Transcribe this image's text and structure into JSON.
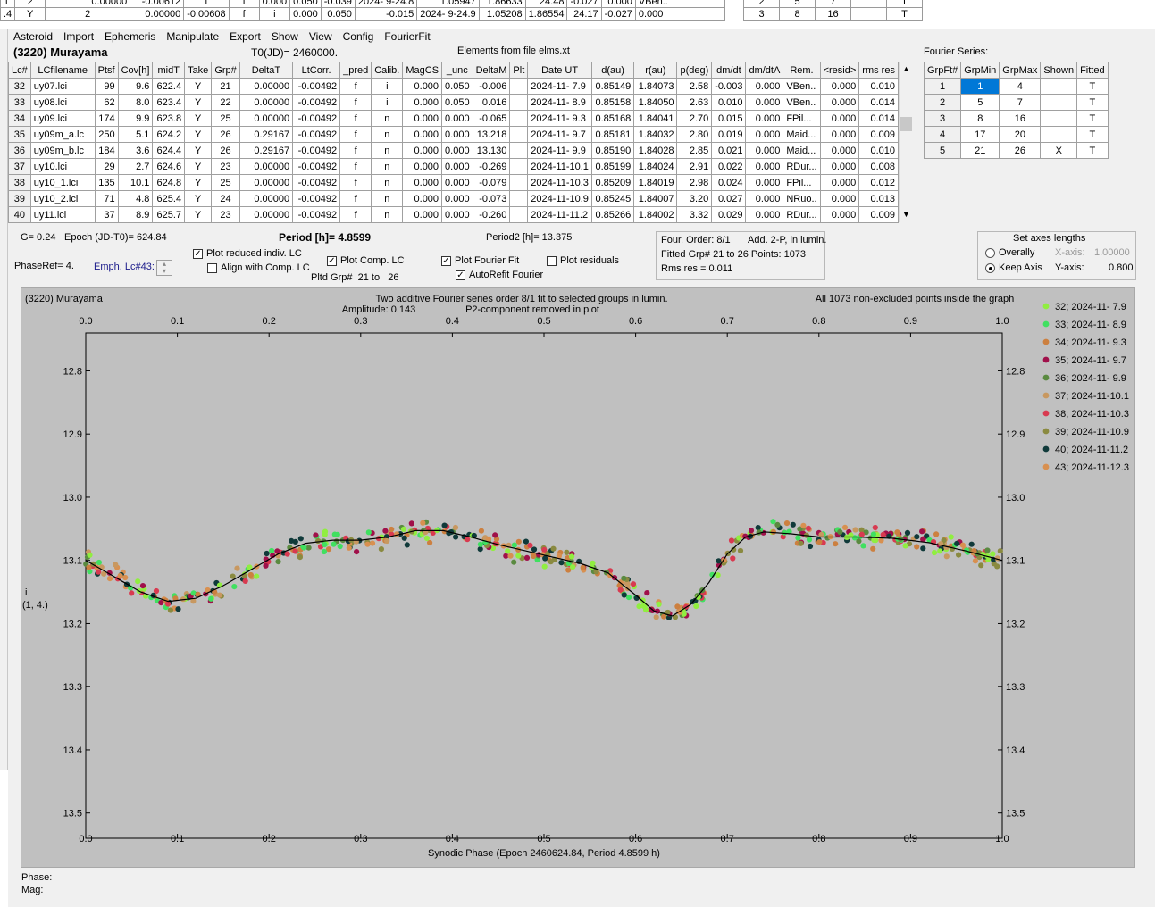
{
  "bg_grid": {
    "rows": [
      [
        "1",
        "2",
        "0.00000",
        "-0.00612",
        "f",
        "i",
        "0.000",
        "0.050",
        "-0.039",
        "2024- 9-24.8",
        "1.05947",
        "1.86633",
        "24.48",
        "-0.027",
        "0.000",
        "VBen.."
      ],
      [
        ".4",
        "Y",
        "2",
        "0.00000",
        "-0.00608",
        "f",
        "i",
        "0.000",
        "0.050",
        "-0.015",
        "2024- 9-24.9",
        "1.05208",
        "1.86554",
        "24.17",
        "-0.027",
        "0.000",
        "VBen.."
      ]
    ],
    "right_rows": [
      [
        "2",
        "5",
        "7",
        "",
        "T"
      ],
      [
        "3",
        "8",
        "16",
        "",
        "T"
      ]
    ]
  },
  "menu": [
    "Asteroid",
    "Import",
    "Ephemeris",
    "Manipulate",
    "Export",
    "Show",
    "View",
    "Config",
    "FourierFit"
  ],
  "header": {
    "asteroid_name": "(3220) Murayama",
    "t0": "T0(JD)= 2460000.",
    "elements_file": "Elements from file elms.xt",
    "fourier_series_label": "Fourier Series:"
  },
  "lc_table": {
    "columns": [
      "Lc#",
      "LCfilename",
      "Ptsf",
      "Cov[h]",
      "midT",
      "Take",
      "Grp#",
      "DeltaT",
      "LtCorr.",
      "_pred",
      "Calib.",
      "MagCS",
      "_unc",
      "DeltaM",
      "Plt",
      "Date UT",
      "d(au)",
      "r(au)",
      "p(deg)",
      "dm/dt",
      "dm/dtA",
      "Rem.",
      "<resid>",
      "rms res"
    ],
    "rows": [
      [
        "32",
        "uy07.lci",
        "99",
        "9.6",
        "622.4",
        "Y",
        "21",
        "0.00000",
        "-0.00492",
        "f",
        "i",
        "0.000",
        "0.050",
        "-0.006",
        "",
        "2024-11- 7.9",
        "0.85149",
        "1.84073",
        "2.58",
        "-0.003",
        "0.000",
        "VBen..",
        "0.000",
        "0.010"
      ],
      [
        "33",
        "uy08.lci",
        "62",
        "8.0",
        "623.4",
        "Y",
        "22",
        "0.00000",
        "-0.00492",
        "f",
        "i",
        "0.000",
        "0.050",
        "0.016",
        "",
        "2024-11- 8.9",
        "0.85158",
        "1.84050",
        "2.63",
        "0.010",
        "0.000",
        "VBen..",
        "0.000",
        "0.014"
      ],
      [
        "34",
        "uy09.lci",
        "174",
        "9.9",
        "623.8",
        "Y",
        "25",
        "0.00000",
        "-0.00492",
        "f",
        "n",
        "0.000",
        "0.000",
        "-0.065",
        "",
        "2024-11- 9.3",
        "0.85168",
        "1.84041",
        "2.70",
        "0.015",
        "0.000",
        "FPil...",
        "0.000",
        "0.014"
      ],
      [
        "35",
        "uy09m_a.lc",
        "250",
        "5.1",
        "624.2",
        "Y",
        "26",
        "0.29167",
        "-0.00492",
        "f",
        "n",
        "0.000",
        "0.000",
        "13.218",
        "",
        "2024-11- 9.7",
        "0.85181",
        "1.84032",
        "2.80",
        "0.019",
        "0.000",
        "Maid...",
        "0.000",
        "0.009"
      ],
      [
        "36",
        "uy09m_b.lc",
        "184",
        "3.6",
        "624.4",
        "Y",
        "26",
        "0.29167",
        "-0.00492",
        "f",
        "n",
        "0.000",
        "0.000",
        "13.130",
        "",
        "2024-11- 9.9",
        "0.85190",
        "1.84028",
        "2.85",
        "0.021",
        "0.000",
        "Maid...",
        "0.000",
        "0.010"
      ],
      [
        "37",
        "uy10.lci",
        "29",
        "2.7",
        "624.6",
        "Y",
        "23",
        "0.00000",
        "-0.00492",
        "f",
        "n",
        "0.000",
        "0.000",
        "-0.269",
        "",
        "2024-11-10.1",
        "0.85199",
        "1.84024",
        "2.91",
        "0.022",
        "0.000",
        "RDur...",
        "0.000",
        "0.008"
      ],
      [
        "38",
        "uy10_1.lci",
        "135",
        "10.1",
        "624.8",
        "Y",
        "25",
        "0.00000",
        "-0.00492",
        "f",
        "n",
        "0.000",
        "0.000",
        "-0.079",
        "",
        "2024-11-10.3",
        "0.85209",
        "1.84019",
        "2.98",
        "0.024",
        "0.000",
        "FPil...",
        "0.000",
        "0.012"
      ],
      [
        "39",
        "uy10_2.lci",
        "71",
        "4.8",
        "625.4",
        "Y",
        "24",
        "0.00000",
        "-0.00492",
        "f",
        "n",
        "0.000",
        "0.000",
        "-0.073",
        "",
        "2024-11-10.9",
        "0.85245",
        "1.84007",
        "3.20",
        "0.027",
        "0.000",
        "NRuo..",
        "0.000",
        "0.013"
      ],
      [
        "40",
        "uy11.lci",
        "37",
        "8.9",
        "625.7",
        "Y",
        "23",
        "0.00000",
        "-0.00492",
        "f",
        "n",
        "0.000",
        "0.000",
        "-0.260",
        "",
        "2024-11-11.2",
        "0.85266",
        "1.84002",
        "3.32",
        "0.029",
        "0.000",
        "RDur...",
        "0.000",
        "0.009"
      ]
    ]
  },
  "fourier_table": {
    "columns": [
      "GrpFt#",
      "GrpMin",
      "GrpMax",
      "Shown",
      "Fitted"
    ],
    "rows": [
      [
        "1",
        "1",
        "4",
        "",
        "T"
      ],
      [
        "2",
        "5",
        "7",
        "",
        "T"
      ],
      [
        "3",
        "8",
        "16",
        "",
        "T"
      ],
      [
        "4",
        "17",
        "20",
        "",
        "T"
      ],
      [
        "5",
        "21",
        "26",
        "X",
        "T"
      ]
    ]
  },
  "info": {
    "g": "G= 0.24",
    "epoch": "Epoch (JD-T0)= 624.84",
    "period": "Period [h]= 4.8599",
    "period2": "Period2 [h]= 13.375",
    "phaseref": "PhaseRef= 4.",
    "emph": "Emph. Lc#43:",
    "plot_reduced": "Plot reduced indiv. LC",
    "align_comp": "Align with Comp. LC",
    "plot_comp": "Plot Comp. LC",
    "pltd_grp": "Pltd Grp#",
    "grp_from": "21",
    "grp_to_label": "to",
    "grp_to": "26",
    "plot_fourier": "Plot Fourier Fit",
    "autorefit": "AutoRefit Fourier",
    "plot_residuals": "Plot residuals",
    "four_order": "Four. Order:  8/1",
    "add_2p": "Add. 2-P,  in lumin.",
    "fitted_grp": "Fitted Grp# 21 to 26 Points: 1073",
    "rms": "Rms res      = 0.011"
  },
  "axes_box": {
    "title": "Set axes lengths",
    "overally": "Overally",
    "keep_axis": "Keep Axis",
    "x_label": "X-axis:",
    "x_value": "1.00000",
    "y_label": "Y-axis:",
    "y_value": "0.800"
  },
  "chart_data": {
    "type": "scatter",
    "top_left": "(3220) Murayama",
    "subtitle1": "Two additive Fourier series order 8/1 fit to selected groups in lumin.",
    "subtitle2": "Amplitude: 0.143",
    "subtitle3": "P2-component removed in plot",
    "top_right": "All 1073 non-excluded points inside the graph",
    "xlabel": "Synodic Phase (Epoch 2460624.84, Period 4.8599 h)",
    "ylabel_line1": "i",
    "ylabel_line2": "(1, 4.)",
    "xlim": [
      0.0,
      1.0
    ],
    "ylim": [
      12.74,
      13.54
    ],
    "y_inverted": true,
    "x_ticks": [
      "0.0",
      "0.1",
      "0.2",
      "0.3",
      "0.4",
      "0.5",
      "0.6",
      "0.7",
      "0.8",
      "0.9",
      "1.0"
    ],
    "y_ticks": [
      "12.8",
      "12.9",
      "13.0",
      "13.1",
      "13.2",
      "13.3",
      "13.4",
      "13.5"
    ],
    "fit_curve": [
      [
        0.0,
        13.1
      ],
      [
        0.03,
        13.125
      ],
      [
        0.06,
        13.15
      ],
      [
        0.09,
        13.165
      ],
      [
        0.12,
        13.16
      ],
      [
        0.15,
        13.14
      ],
      [
        0.18,
        13.115
      ],
      [
        0.21,
        13.09
      ],
      [
        0.24,
        13.073
      ],
      [
        0.27,
        13.068
      ],
      [
        0.3,
        13.068
      ],
      [
        0.33,
        13.063
      ],
      [
        0.36,
        13.053
      ],
      [
        0.39,
        13.053
      ],
      [
        0.42,
        13.063
      ],
      [
        0.45,
        13.075
      ],
      [
        0.48,
        13.085
      ],
      [
        0.51,
        13.095
      ],
      [
        0.54,
        13.105
      ],
      [
        0.57,
        13.12
      ],
      [
        0.6,
        13.155
      ],
      [
        0.62,
        13.18
      ],
      [
        0.64,
        13.188
      ],
      [
        0.66,
        13.17
      ],
      [
        0.68,
        13.135
      ],
      [
        0.7,
        13.09
      ],
      [
        0.72,
        13.063
      ],
      [
        0.74,
        13.055
      ],
      [
        0.77,
        13.058
      ],
      [
        0.8,
        13.063
      ],
      [
        0.84,
        13.063
      ],
      [
        0.88,
        13.065
      ],
      [
        0.92,
        13.072
      ],
      [
        0.96,
        13.085
      ],
      [
        1.0,
        13.1
      ]
    ],
    "series": [
      {
        "name": "32; 2024-11- 7.9",
        "color": "#90ee40"
      },
      {
        "name": "33; 2024-11- 8.9",
        "color": "#40e060"
      },
      {
        "name": "34; 2024-11- 9.3",
        "color": "#cc8040"
      },
      {
        "name": "35; 2024-11- 9.7",
        "color": "#a0104a"
      },
      {
        "name": "36; 2024-11- 9.9",
        "color": "#5a8a40"
      },
      {
        "name": "37; 2024-11-10.1",
        "color": "#c89860"
      },
      {
        "name": "38; 2024-11-10.3",
        "color": "#d83a50"
      },
      {
        "name": "39; 2024-11-10.9",
        "color": "#8a8a40"
      },
      {
        "name": "40; 2024-11-11.2",
        "color": "#103a3a"
      },
      {
        "name": "43; 2024-11-12.3",
        "color": "#d89050"
      }
    ]
  },
  "status": {
    "phase": "Phase:",
    "mag": "Mag:"
  }
}
